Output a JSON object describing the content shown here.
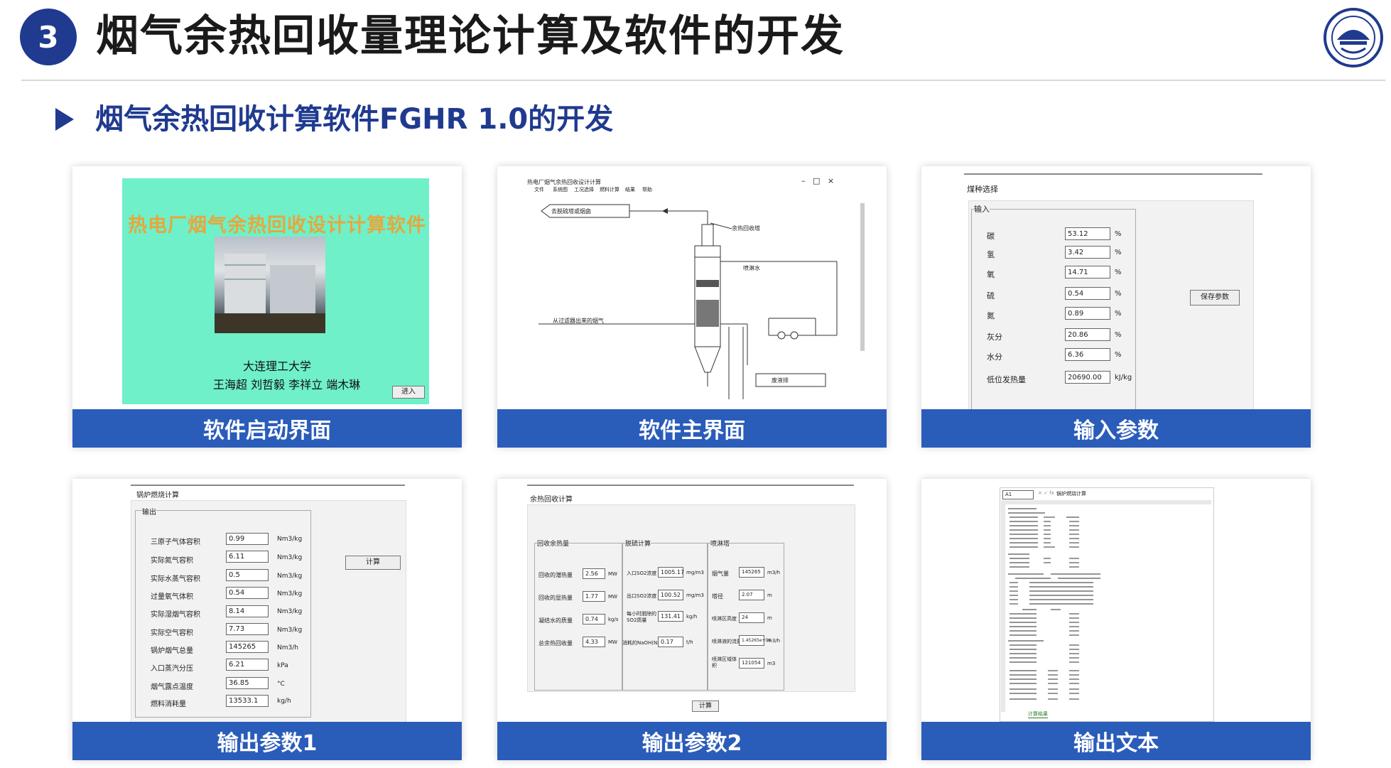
{
  "header": {
    "number": "3",
    "title": "烟气余热回收量理论计算及软件的开发",
    "subtitle": "烟气余热回收计算软件FGHR 1.0的开发"
  },
  "colors": {
    "accent": "#2a5cba",
    "badge": "#1f3a8f",
    "splash_bg": "#6ff0c9"
  },
  "cards": {
    "splash": {
      "caption": "软件启动界面",
      "app_title": "热电厂烟气余热回收设计计算软件",
      "university": "大连理工大学",
      "authors": "王海超 刘哲毅 李祥立 端木琳",
      "enter_button": "进入"
    },
    "main": {
      "caption": "软件主界面",
      "window_title": "热电厂烟气余热回收设计计算",
      "menu": [
        "文件",
        "系统图",
        "工况选择",
        "燃料计算",
        "结果",
        "帮助"
      ],
      "labels": {
        "to_stack": "去脱硫塔或烟囱",
        "heat_pump": "余热回收塔",
        "spray_water": "喷淋水",
        "from_precip": "从过滤器出来的烟气",
        "drain": "废液排"
      }
    },
    "input": {
      "caption": "输入参数",
      "tab": "煤种选择",
      "group": "输入",
      "rows": [
        {
          "label": "碳",
          "value": "53.12",
          "unit": "%"
        },
        {
          "label": "氢",
          "value": "3.42",
          "unit": "%"
        },
        {
          "label": "氧",
          "value": "14.71",
          "unit": "%"
        },
        {
          "label": "硫",
          "value": "0.54",
          "unit": "%"
        },
        {
          "label": "氮",
          "value": "0.89",
          "unit": "%"
        },
        {
          "label": "灰分",
          "value": "20.86",
          "unit": "%"
        },
        {
          "label": "水分",
          "value": "6.36",
          "unit": "%"
        },
        {
          "label": "低位发热量",
          "value": "20690.00",
          "unit": "kJ/kg"
        }
      ],
      "save_button": "保存参数"
    },
    "output1": {
      "caption": "输出参数1",
      "tab": "锅炉燃烧计算",
      "group": "输出",
      "rows": [
        {
          "label": "三原子气体容积",
          "value": "0.99",
          "unit": "Nm3/kg"
        },
        {
          "label": "实际氮气容积",
          "value": "6.11",
          "unit": "Nm3/kg"
        },
        {
          "label": "实际水蒸气容积",
          "value": "0.5",
          "unit": "Nm3/kg"
        },
        {
          "label": "过量氧气体积",
          "value": "0.54",
          "unit": "Nm3/kg"
        },
        {
          "label": "实际湿烟气容积",
          "value": "8.14",
          "unit": "Nm3/kg"
        },
        {
          "label": "实际空气容积",
          "value": "7.73",
          "unit": "Nm3/kg"
        },
        {
          "label": "锅炉烟气总量",
          "value": "145265",
          "unit": "Nm3/h"
        },
        {
          "label": "入口蒸汽分压",
          "value": "6.21",
          "unit": "kPa"
        },
        {
          "label": "烟气露点温度",
          "value": "36.85",
          "unit": "°C"
        },
        {
          "label": "燃料消耗量",
          "value": "13533.1",
          "unit": "kg/h"
        }
      ],
      "calc_button": "计算"
    },
    "output2": {
      "caption": "输出参数2",
      "tab": "余热回收计算",
      "groups": {
        "g1": {
          "title": "回收余热量",
          "rows": [
            {
              "label": "回收的潜热量",
              "value": "2.56",
              "unit": "MW"
            },
            {
              "label": "回收的显热量",
              "value": "1.77",
              "unit": "MW"
            },
            {
              "label": "凝结水的质量",
              "value": "0.74",
              "unit": "kg/s"
            },
            {
              "label": "总余热回收量",
              "value": "4.33",
              "unit": "MW"
            }
          ]
        },
        "g2": {
          "title": "脱硫计算",
          "rows": [
            {
              "label": "入口SO2浓度",
              "value": "1005.17",
              "unit": "mg/m3"
            },
            {
              "label": "出口SO2浓度",
              "value": "100.52",
              "unit": "mg/m3"
            },
            {
              "label": "每小时脱除的SO2质量",
              "value": "131.41",
              "unit": "kg/h"
            },
            {
              "label": "消耗的NaOH(Na2CO3)",
              "value": "0.17",
              "unit": "t/h"
            }
          ]
        },
        "g3": {
          "title": "喷淋塔",
          "rows": [
            {
              "label": "烟气量",
              "value": "145265",
              "unit": "m3/h"
            },
            {
              "label": "塔径",
              "value": "2.07",
              "unit": "m"
            },
            {
              "label": "喷淋区高度",
              "value": "24",
              "unit": "m"
            },
            {
              "label": "喷淋液的流量",
              "value": "1.45265e+06",
              "unit": "m3/h"
            },
            {
              "label": "喷淋区域体积",
              "value": "121054",
              "unit": "m3"
            }
          ]
        }
      },
      "calc_button": "计算"
    },
    "text": {
      "caption": "输出文本",
      "cell_ref": "A1",
      "formula": "锅炉燃烧计算",
      "sheet_tab": "计算结果"
    }
  }
}
